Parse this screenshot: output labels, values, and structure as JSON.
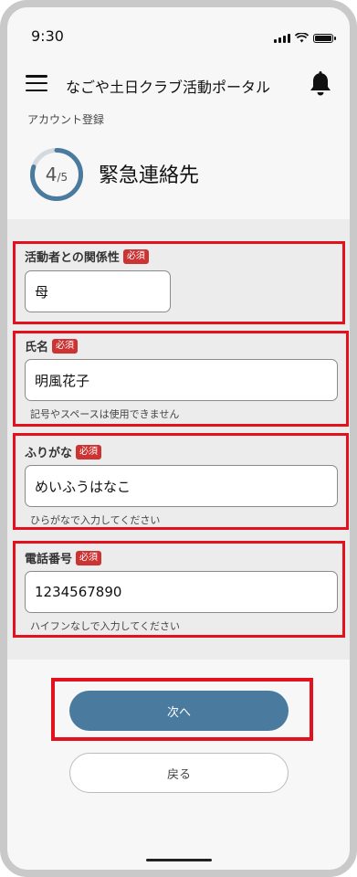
{
  "status_bar": {
    "time": "9:30"
  },
  "header": {
    "title": "なごや土日クラブ活動ポータル"
  },
  "breadcrumb": "アカウント登録",
  "progress": {
    "current": "4",
    "total": "/5",
    "fraction": 0.8
  },
  "step_title": "緊急連絡先",
  "required_badge": "必須",
  "fields": [
    {
      "label": "活動者との関係性",
      "value": "母",
      "hint": ""
    },
    {
      "label": "氏名",
      "value": "明風花子",
      "hint": "記号やスペースは使用できません"
    },
    {
      "label": "ふりがな",
      "value": "めいふうはなこ",
      "hint": "ひらがなで入力してください"
    },
    {
      "label": "電話番号",
      "value": "1234567890",
      "hint": "ハイフンなしで入力してください"
    }
  ],
  "buttons": {
    "next": "次へ",
    "back": "戻る"
  },
  "colors": {
    "primary": "#4a7a9d",
    "highlight": "#e3101e",
    "required_badge": "#cc3333"
  }
}
